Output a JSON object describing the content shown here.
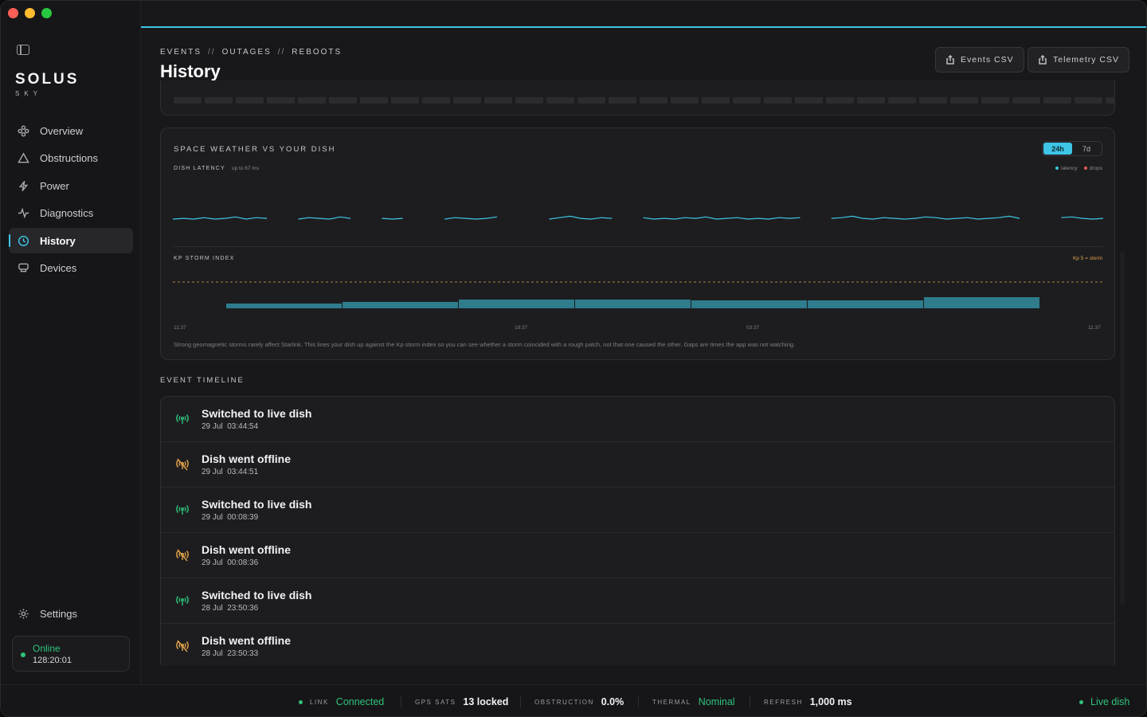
{
  "app": {
    "brand": "SOLUS",
    "brand_sub": "SKY"
  },
  "colors": {
    "accent": "#3ec5e6",
    "good": "#2fc37a",
    "warn": "#e2a24a",
    "bar": "#2e7c8c"
  },
  "sidebar": {
    "items": [
      {
        "label": "Overview",
        "icon": "overview-icon"
      },
      {
        "label": "Obstructions",
        "icon": "triangle-icon"
      },
      {
        "label": "Power",
        "icon": "bolt-icon"
      },
      {
        "label": "Diagnostics",
        "icon": "pulse-icon"
      },
      {
        "label": "History",
        "icon": "history-icon",
        "active": true
      },
      {
        "label": "Devices",
        "icon": "router-icon"
      }
    ],
    "settings_label": "Settings",
    "status": {
      "state": "Online",
      "uptime": "128:20:01"
    }
  },
  "header": {
    "crumbs": [
      "EVENTS",
      "OUTAGES",
      "REBOOTS"
    ],
    "crumb_sep": "//",
    "title": "History",
    "buttons": {
      "events_csv": "Events CSV",
      "telemetry_csv": "Telemetry CSV"
    }
  },
  "strip": {
    "cells": [
      0,
      0,
      0,
      0,
      0,
      0,
      0,
      0,
      0,
      0,
      0,
      0,
      0,
      0,
      0,
      0,
      0,
      0,
      0,
      0,
      0,
      0,
      0,
      0,
      0,
      0,
      0,
      0,
      0,
      0,
      0,
      0,
      0,
      0,
      0,
      0,
      0,
      0,
      0,
      0,
      0,
      0,
      0,
      0,
      0,
      0,
      1,
      0,
      1,
      1
    ]
  },
  "space_weather": {
    "title": "SPACE WEATHER VS YOUR DISH",
    "ranges": [
      "24h",
      "7d"
    ],
    "selected_range": "24h",
    "latency_label": "DISH LATENCY",
    "latency_note": "up to 67 ms",
    "legend": [
      "latency",
      "drops"
    ],
    "kp_label": "KP STORM INDEX",
    "kp_threshold_label": "Kp 5 = storm",
    "ticks": [
      "11:37",
      "19:37",
      "03:37",
      "11:37"
    ],
    "caption": "Strong geomagnetic storms rarely affect Starlink. This lines your dish up against the Kp storm index so you can see whether a storm coincided with a rough patch, not that one caused the other. Gaps are times the app was not watching."
  },
  "chart_data": [
    {
      "type": "line",
      "title": "DISH LATENCY",
      "series": [
        {
          "name": "latency",
          "values": [
            40,
            41,
            40,
            42,
            40,
            41,
            43,
            40,
            42,
            41,
            40,
            41,
            40,
            42,
            41,
            40,
            43,
            41,
            40,
            42,
            41,
            40,
            41,
            42,
            40,
            41,
            40,
            42,
            41,
            40,
            41,
            43,
            41,
            42,
            40,
            41,
            40,
            42,
            44,
            41,
            40,
            42,
            41,
            40,
            41,
            42,
            40,
            41,
            40,
            42,
            41,
            43,
            40,
            41,
            42,
            40,
            41,
            40,
            42,
            41,
            42,
            43,
            40,
            41,
            42,
            44,
            41,
            40,
            42,
            41,
            40,
            41,
            43,
            42,
            40,
            41,
            42,
            40,
            41,
            42,
            44,
            41,
            42,
            40,
            41,
            42,
            43,
            41,
            40,
            41
          ]
        }
      ]
    },
    {
      "type": "bar",
      "title": "KP STORM INDEX",
      "categories": [
        "1",
        "2",
        "3",
        "4",
        "5",
        "6",
        "7",
        "8"
      ],
      "values": [
        0.6,
        0.8,
        1.1,
        1.1,
        1.0,
        1.0,
        1.4,
        0
      ],
      "threshold": 5,
      "ylim": [
        0,
        5
      ]
    }
  ],
  "timeline": {
    "title": "EVENT TIMELINE",
    "events": [
      {
        "title": "Switched to live dish",
        "time": "29 Jul  03:44:54",
        "kind": "live"
      },
      {
        "title": "Dish went offline",
        "time": "29 Jul  03:44:51",
        "kind": "offline"
      },
      {
        "title": "Switched to live dish",
        "time": "29 Jul  00:08:39",
        "kind": "live"
      },
      {
        "title": "Dish went offline",
        "time": "29 Jul  00:08:36",
        "kind": "offline"
      },
      {
        "title": "Switched to live dish",
        "time": "28 Jul  23:50:36",
        "kind": "live"
      },
      {
        "title": "Dish went offline",
        "time": "28 Jul  23:50:33",
        "kind": "offline"
      }
    ]
  },
  "footer": {
    "link": {
      "key": "LINK",
      "value": "Connected"
    },
    "gps": {
      "key": "GPS SATS",
      "value": "13 locked"
    },
    "obstruction": {
      "key": "OBSTRUCTION",
      "value": "0.0%"
    },
    "thermal": {
      "key": "THERMAL",
      "value": "Nominal"
    },
    "refresh": {
      "key": "REFRESH",
      "value": "1,000 ms"
    },
    "mode": "Live dish"
  }
}
